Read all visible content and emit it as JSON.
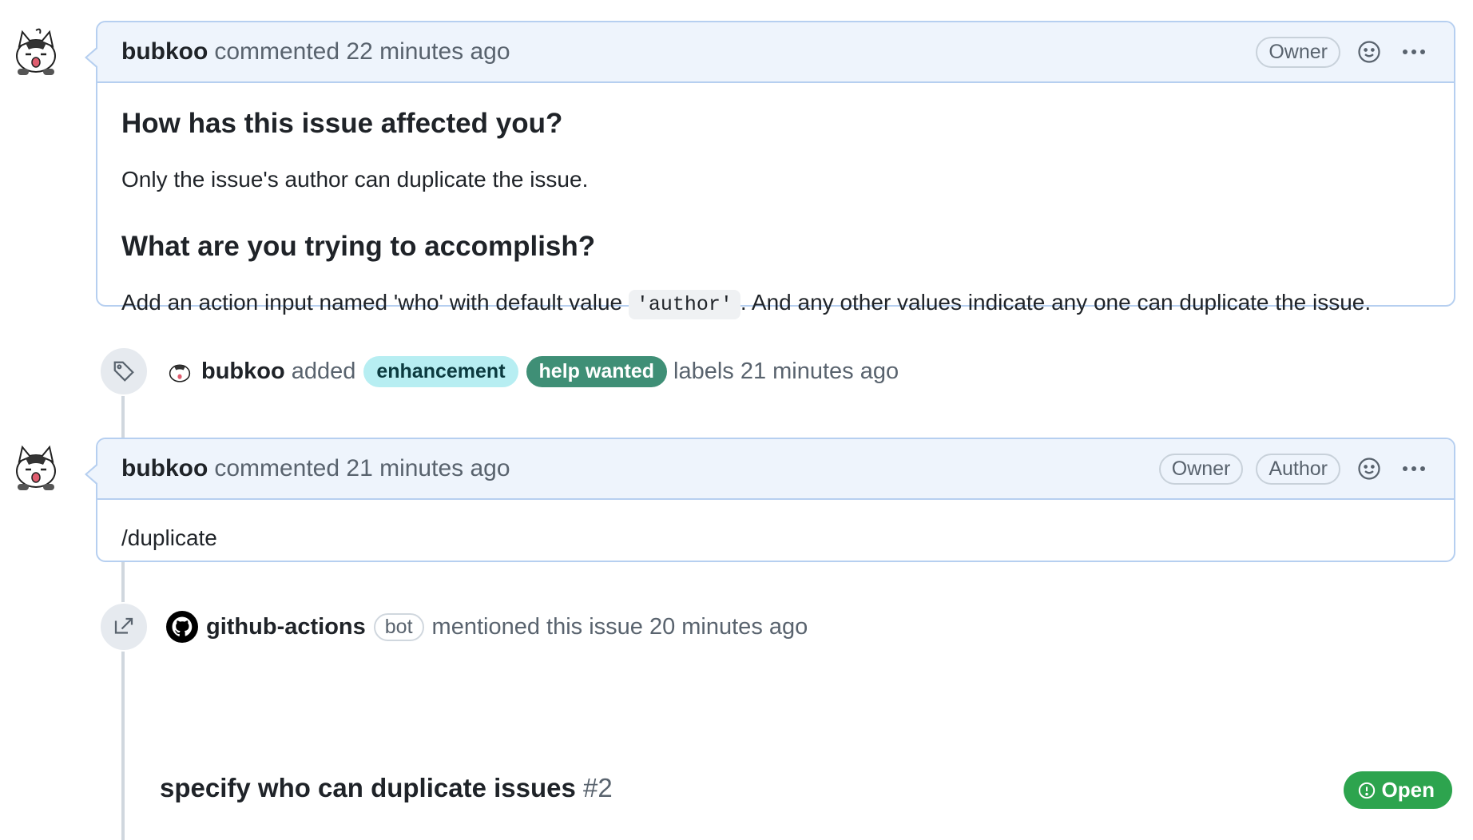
{
  "comments": [
    {
      "author": "bubkoo",
      "meta": "commented 22 minutes ago",
      "badges": [
        "Owner"
      ],
      "heading1": "How has this issue affected you?",
      "para1": "Only the issue's author can duplicate the issue.",
      "heading2": "What are you trying to accomplish?",
      "para2_before": "Add an action input named 'who' with default value ",
      "para2_code": "'author'",
      "para2_after": ". And any other values indicate any one can duplicate the issue."
    },
    {
      "author": "bubkoo",
      "meta": "commented 21 minutes ago",
      "badges": [
        "Owner",
        "Author"
      ],
      "body": "/duplicate"
    }
  ],
  "label_event": {
    "actor": "bubkoo",
    "verb": "added",
    "labels": [
      {
        "name": "enhancement",
        "bg": "#b7eef2",
        "fg": "#0b3a3f"
      },
      {
        "name": "help wanted",
        "bg": "#3f8f76",
        "fg": "#ffffff"
      }
    ],
    "suffix": "labels 21 minutes ago"
  },
  "mention_event": {
    "actor": "github-actions",
    "badge": "bot",
    "text": "mentioned this issue 20 minutes ago",
    "ref_title": "specify who can duplicate issues",
    "ref_number": "#2",
    "state": "Open"
  },
  "colors": {
    "accent_border": "#b6cff0",
    "header_bg": "#eef4fc",
    "open_green": "#2da44e"
  }
}
